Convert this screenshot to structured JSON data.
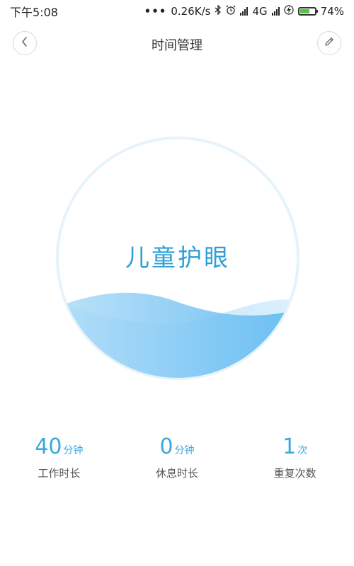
{
  "status_bar": {
    "time": "下午5:08",
    "dots": "•••",
    "speed": "0.26K/s",
    "network": "4G",
    "battery": "74%",
    "battery_level": 0.74
  },
  "header": {
    "title": "时间管理"
  },
  "circle": {
    "title": "儿童护眼"
  },
  "stats": [
    {
      "value": "40",
      "unit": "分钟",
      "label": "工作时长"
    },
    {
      "value": "0",
      "unit": "分钟",
      "label": "休息时长"
    },
    {
      "value": "1",
      "unit": "次",
      "label": "重复次数"
    }
  ],
  "colors": {
    "accent": "#3aa8dc",
    "circle_border": "#e3f1fa",
    "wave_light": "#cde9fb",
    "wave_dark": "#6cc0f3"
  }
}
